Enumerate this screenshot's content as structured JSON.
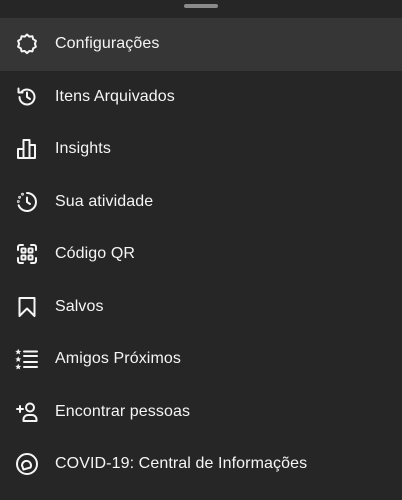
{
  "menu": {
    "items": [
      {
        "label": "Configurações",
        "icon": "settings-gear-icon",
        "active": true
      },
      {
        "label": "Itens Arquivados",
        "icon": "archive-history-icon"
      },
      {
        "label": "Insights",
        "icon": "bar-chart-icon"
      },
      {
        "label": "Sua atividade",
        "icon": "activity-clock-icon"
      },
      {
        "label": "Código QR",
        "icon": "qr-code-icon"
      },
      {
        "label": "Salvos",
        "icon": "bookmark-icon"
      },
      {
        "label": "Amigos Próximos",
        "icon": "close-friends-list-icon"
      },
      {
        "label": "Encontrar pessoas",
        "icon": "add-person-icon"
      },
      {
        "label": "COVID-19: Central de Informações",
        "icon": "covid-info-icon"
      }
    ]
  },
  "colors": {
    "background": "#262626",
    "active_row": "#363636",
    "text": "#f5f5f5",
    "handle": "#8a8a8a"
  }
}
